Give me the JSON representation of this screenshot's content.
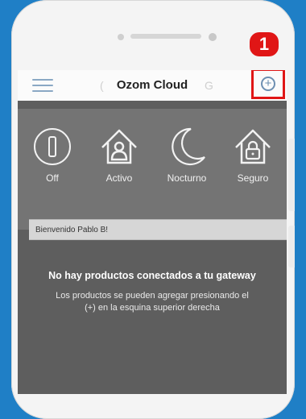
{
  "app": {
    "title": "Ozom Cloud",
    "ghost_left": "(",
    "ghost_right": "G"
  },
  "annotation": {
    "step_number": "1"
  },
  "icons": {
    "menu": "hamburger-menu-icon",
    "add": "plus-circle-icon"
  },
  "modes": [
    {
      "label": "Off",
      "icon": "power-icon"
    },
    {
      "label": "Activo",
      "icon": "home-person-icon"
    },
    {
      "label": "Nocturno",
      "icon": "moon-icon"
    },
    {
      "label": "Seguro",
      "icon": "home-lock-icon"
    }
  ],
  "welcome_text": "Bienvenido Pablo B!",
  "empty_state": {
    "title": "No hay productos conectados a tu gateway",
    "description_line1": "Los productos se pueden agregar presionando el",
    "description_line2": "(+) en la esquina superior derecha"
  },
  "colors": {
    "background": "#1f7fc6",
    "highlight": "#e01616",
    "accent": "#6d8fb2"
  }
}
